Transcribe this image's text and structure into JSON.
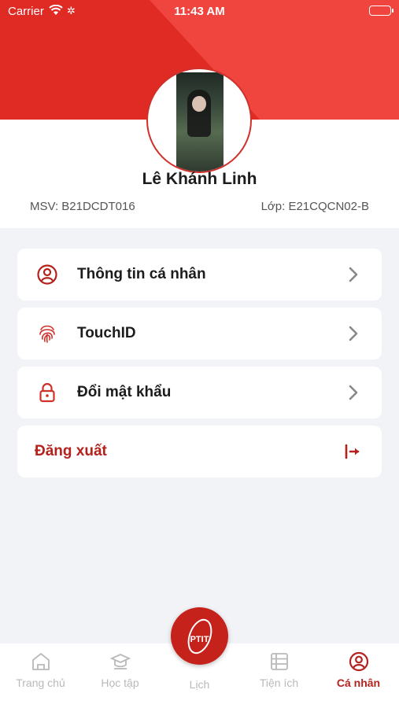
{
  "status_bar": {
    "carrier": "Carrier",
    "time": "11:43 AM"
  },
  "profile": {
    "name": "Lê Khánh Linh",
    "msv": "MSV: B21DCDT016",
    "lop": "Lớp: E21CQCN02-B"
  },
  "menu": [
    {
      "label": "Thông tin cá nhân",
      "icon": "user-circle-icon"
    },
    {
      "label": "TouchID",
      "icon": "fingerprint-icon"
    },
    {
      "label": "Đổi mật khẩu",
      "icon": "lock-icon"
    }
  ],
  "logout": {
    "label": "Đăng xuất",
    "icon": "logout-icon"
  },
  "tabs": [
    {
      "label": "Trang chủ",
      "icon": "home-icon"
    },
    {
      "label": "Học tập",
      "icon": "graduation-cap-icon"
    },
    {
      "label": "Lịch",
      "icon": "calendar-icon"
    },
    {
      "label": "Tiện ích",
      "icon": "utilities-icon"
    },
    {
      "label": "Cá nhân",
      "icon": "user-circle-icon"
    }
  ],
  "fab": {
    "logo_text": "PTIT"
  },
  "colors": {
    "brand_red": "#e02a24",
    "accent_dark_red": "#b3221d",
    "inactive_tab": "#b9b9b9",
    "background": "#f2f3f7"
  }
}
